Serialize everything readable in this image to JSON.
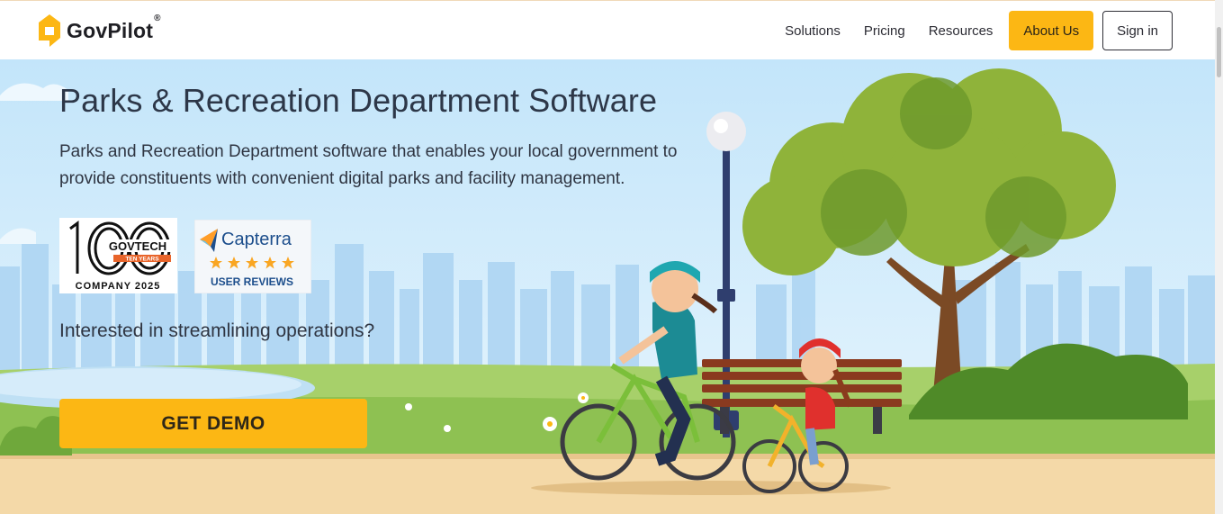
{
  "header": {
    "brand": "GovPilot",
    "brand_mark": "®",
    "nav": {
      "solutions": "Solutions",
      "pricing": "Pricing",
      "resources": "Resources",
      "about": "About Us",
      "signin": "Sign in"
    }
  },
  "hero": {
    "title": "Parks & Recreation Department Software",
    "description": "Parks and Recreation Department software that enables your local government to provide constituents with convenient digital parks and facility management.",
    "question": "Interested in streamlining operations?",
    "cta": "GET DEMO"
  },
  "badges": {
    "govtech": {
      "number": "100",
      "name": "GOVTECH",
      "ribbon": "TEN YEARS",
      "caption": "COMPANY 2025"
    },
    "capterra": {
      "name": "Capterra",
      "caption": "USER REVIEWS",
      "stars": 5
    }
  },
  "colors": {
    "accent": "#fcb714",
    "sky": "#cfeafb",
    "grass": "#8cc152",
    "path": "#f4d9a8",
    "text": "#2d3748"
  },
  "icons": {
    "logo": "location-pin-house-icon",
    "star": "star-icon"
  }
}
